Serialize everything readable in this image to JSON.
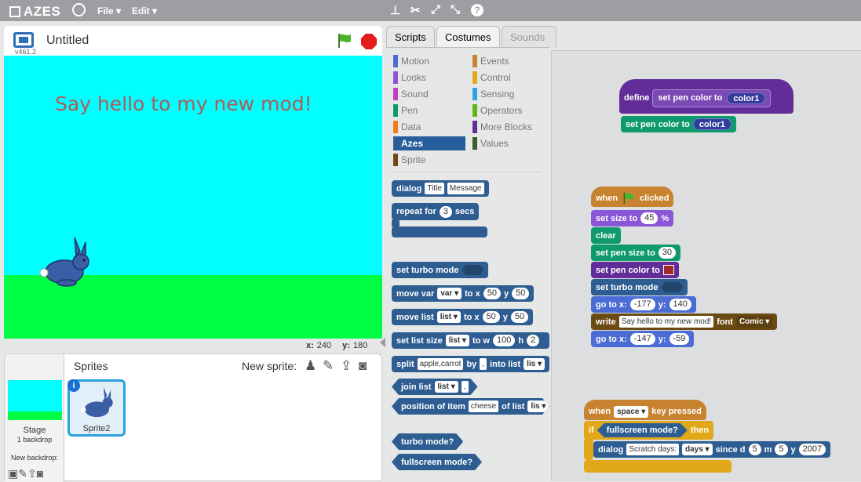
{
  "app": {
    "name": "AZES",
    "version": "v461.2",
    "project_title": "Untitled"
  },
  "menu": {
    "file": "File",
    "edit": "Edit"
  },
  "stage": {
    "message": "Say hello to my new mod!",
    "x_label": "x:",
    "x_value": "240",
    "y_label": "y:",
    "y_value": "180"
  },
  "sprites_panel": {
    "title": "Sprites",
    "new_sprite_label": "New sprite:",
    "stage_label": "Stage",
    "backdrop_count": "1 backdrop",
    "new_backdrop_label": "New backdrop:",
    "sprite_name": "Sprite2",
    "info_glyph": "i"
  },
  "tabs": {
    "scripts": "Scripts",
    "costumes": "Costumes",
    "sounds": "Sounds"
  },
  "categories": {
    "motion": "Motion",
    "looks": "Looks",
    "sound": "Sound",
    "pen": "Pen",
    "data": "Data",
    "azes": "Azes",
    "sprite": "Sprite",
    "events": "Events",
    "control": "Control",
    "sensing": "Sensing",
    "operators": "Operators",
    "more_blocks": "More Blocks",
    "values": "Values"
  },
  "palette": {
    "dialog": "dialog",
    "dialog_title": "Title",
    "dialog_msg": "Message",
    "repeat_for": "repeat for",
    "repeat_n": "3",
    "secs": "secs",
    "set_turbo": "set turbo mode",
    "move_var": "move var",
    "var_dd": "var",
    "to_x": "to x",
    "n50a": "50",
    "y": "y",
    "n50b": "50",
    "move_list": "move list",
    "list_dd": "list",
    "set_list_size": "set list size",
    "to_w": "to w",
    "n100": "100",
    "h": "h",
    "n2": "2",
    "split": "split",
    "split_text": "apple,carrot",
    "by": "by",
    "comma": ",",
    "into_list": "into list",
    "li": "lis",
    "join_list": "join list",
    "position_of_item": "position of item",
    "cheese": "cheese",
    "of_list": "of list",
    "turbo_q": "turbo mode?",
    "fullscreen_q": "fullscreen mode?"
  },
  "scripts": {
    "define": "define",
    "set_pen_color_to": "set pen color to",
    "color1": "color1",
    "when": "when",
    "clicked": "clicked",
    "set_size_to": "set size to",
    "size_val": "45",
    "pct": "%",
    "clear": "clear",
    "set_pen_size_to": "set pen size to",
    "pen_size": "30",
    "go_to_x": "go to x:",
    "gx1": "-177",
    "y_lbl": "y:",
    "gy1": "140",
    "write": "write",
    "write_text": "Say hello to my new mod!",
    "font": "font",
    "font_val": "Comic",
    "gx2": "-147",
    "gy2": "-59",
    "key_pressed": "key pressed",
    "space": "space",
    "if": "if",
    "then": "then",
    "scratch_days": "Scratch days:",
    "days": "days",
    "since_d": "since d",
    "d5": "5",
    "m": "m",
    "m5": "5",
    "y_word": "y",
    "yr": "2007"
  },
  "colors": {
    "motion": "#4a6cd4",
    "looks": "#8a55d7",
    "sound": "#bb42c3",
    "pen": "#0e9a6c",
    "data": "#ee7d16",
    "azes": "#2e5d91",
    "sprite": "#6b4a14",
    "events": "#c88330",
    "control": "#e1a91a",
    "sensing": "#2ca5e2",
    "operators": "#5cb712",
    "more_blocks": "#632d99",
    "values": "#3b5d2b"
  }
}
